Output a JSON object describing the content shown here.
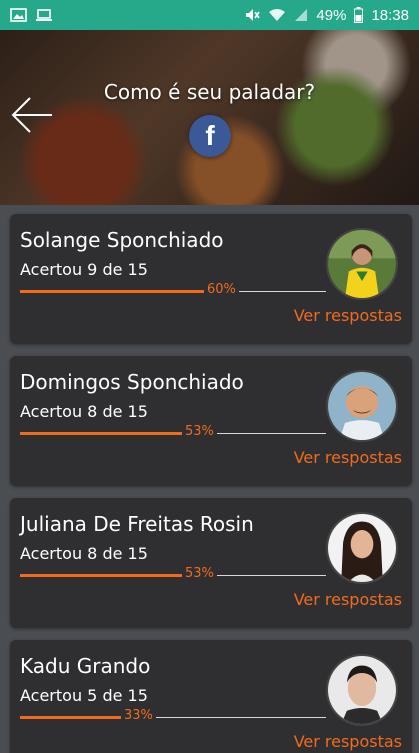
{
  "status_bar": {
    "battery": "49%",
    "time": "18:38",
    "left_icons": [
      "image-icon",
      "laptop-icon"
    ],
    "right_icons": [
      "mute-icon",
      "wifi-icon",
      "signal-icon",
      "battery-icon"
    ]
  },
  "header": {
    "title": "Como é seu paladar?",
    "back_icon": "arrow-left-icon",
    "facebook_icon": "facebook-icon"
  },
  "colors": {
    "status_bar": "#26a98a",
    "accent": "#f26b1d",
    "card_bg": "#2f2f32",
    "facebook": "#3b5998"
  },
  "results": [
    {
      "name": "Solange Sponchiado",
      "score": "Acertou 9 de 15",
      "percent_label": "60%",
      "progress": 0.6,
      "link": "Ver respostas"
    },
    {
      "name": "Domingos Sponchiado",
      "score": "Acertou 8 de 15",
      "percent_label": "53%",
      "progress": 0.53,
      "link": "Ver respostas"
    },
    {
      "name": "Juliana De Freitas Rosin",
      "score": "Acertou 8 de 15",
      "percent_label": "53%",
      "progress": 0.53,
      "link": "Ver respostas"
    },
    {
      "name": "Kadu Grando",
      "score": "Acertou 5 de 15",
      "percent_label": "33%",
      "progress": 0.33,
      "link": "Ver respostas"
    }
  ]
}
